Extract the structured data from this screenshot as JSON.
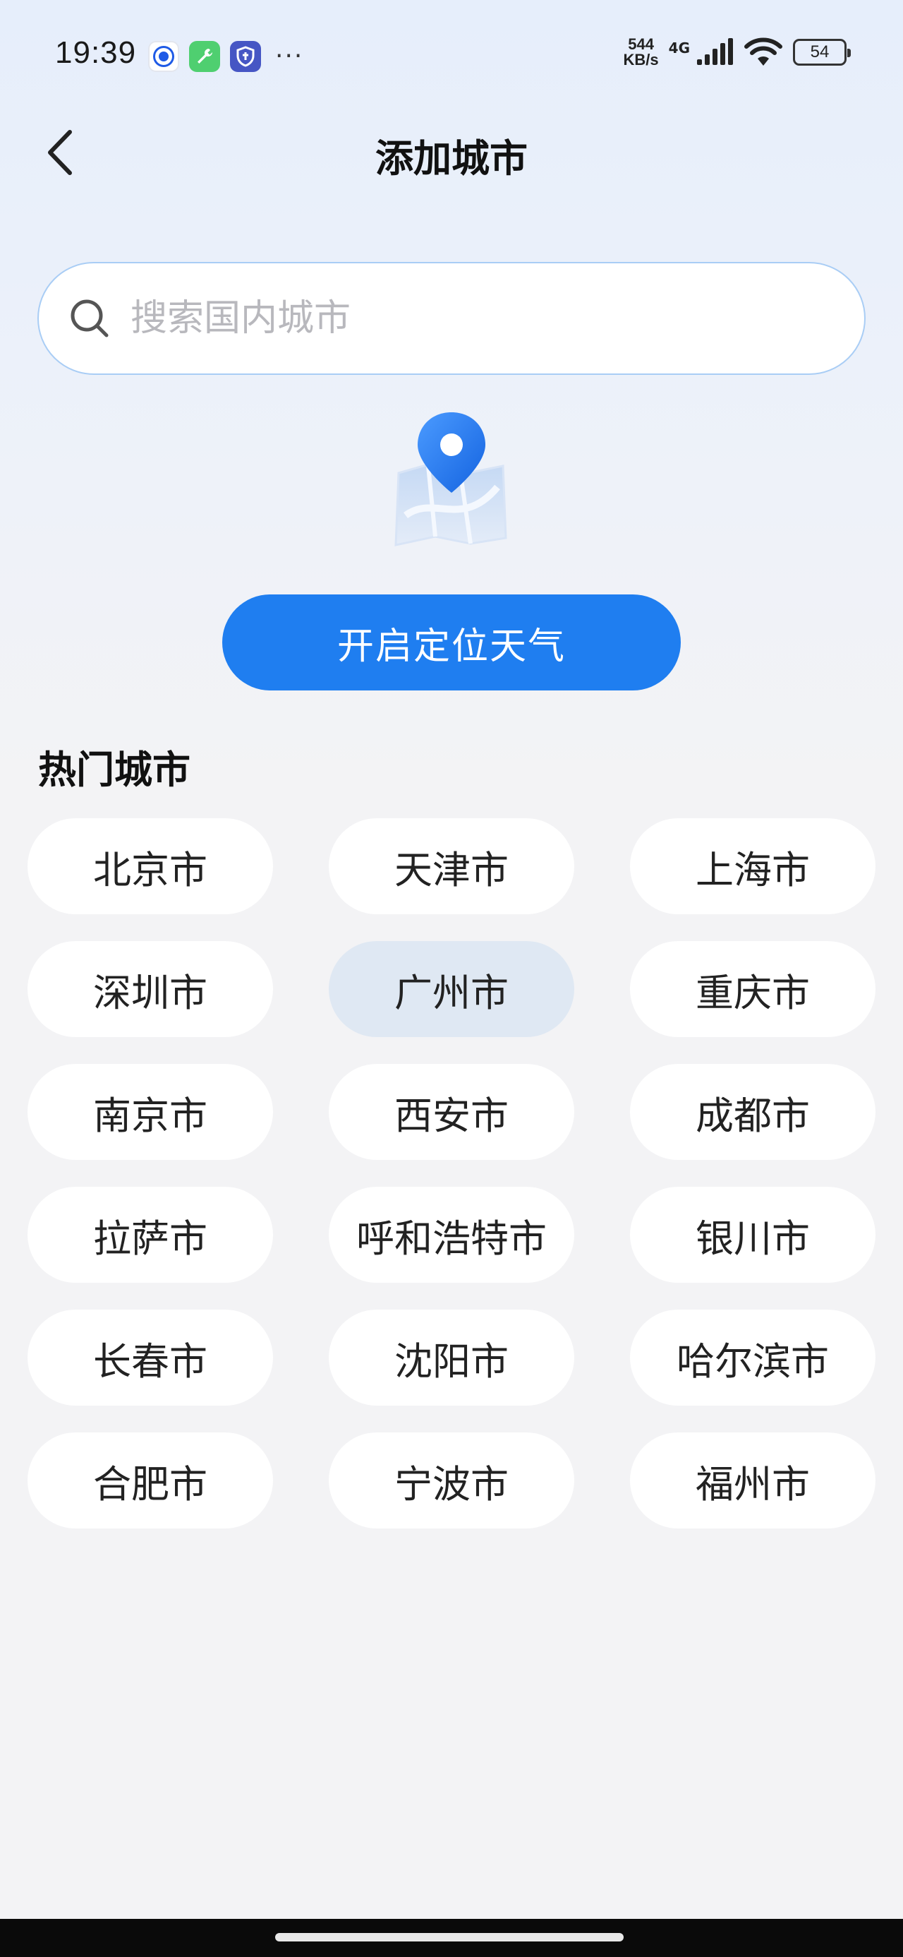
{
  "status_bar": {
    "time": "19:39",
    "net_speed_value": "544",
    "net_speed_unit": "KB/s",
    "net_type": "4G",
    "battery": "54"
  },
  "header": {
    "title": "添加城市"
  },
  "search": {
    "placeholder": "搜索国内城市"
  },
  "location": {
    "button_label": "开启定位天气"
  },
  "hot_cities": {
    "title": "热门城市",
    "selected": "广州市",
    "cities": [
      "北京市",
      "天津市",
      "上海市",
      "深圳市",
      "广州市",
      "重庆市",
      "南京市",
      "西安市",
      "成都市",
      "拉萨市",
      "呼和浩特市",
      "银川市",
      "长春市",
      "沈阳市",
      "哈尔滨市",
      "合肥市",
      "宁波市",
      "福州市"
    ]
  },
  "colors": {
    "accent": "#1f7ef0",
    "selected_chip": "#dfe8f3",
    "search_border": "#a9cdf5"
  }
}
